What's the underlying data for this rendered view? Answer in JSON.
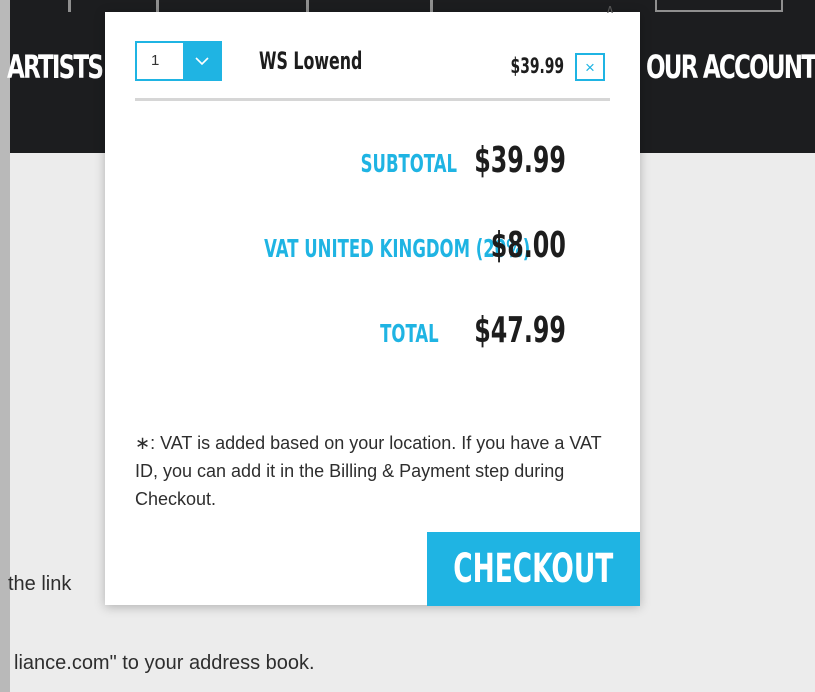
{
  "nav": {
    "artists": "ARTISTS",
    "your_account": "OUR ACCOUNT"
  },
  "page": {
    "line1": "the link",
    "line2": "liance.com\" to your address book."
  },
  "cart": {
    "item": {
      "quantity": "1",
      "name": "WS Lowend",
      "price": "$39.99",
      "remove_symbol": "×"
    },
    "subtotal_label": "SUBTOTAL",
    "subtotal_value": "$39.99",
    "vat_label": "VAT UNITED KINGDOM (20%)",
    "vat_value": "$8.00",
    "total_label": "TOTAL",
    "total_value": "$47.99",
    "vat_note": "∗: VAT is added based on your location. If you have a VAT ID, you can add it in the Billing & Payment step during Checkout.",
    "checkout_label": "CHECKOUT"
  },
  "colors": {
    "accent": "#1fb4e3",
    "nav_background": "#1c1d1f",
    "page_background": "#ececec"
  },
  "icons": {
    "quantity_dropdown": "chevron-down-icon",
    "remove": "close-icon",
    "popup_pointer": "caret-up-icon"
  }
}
